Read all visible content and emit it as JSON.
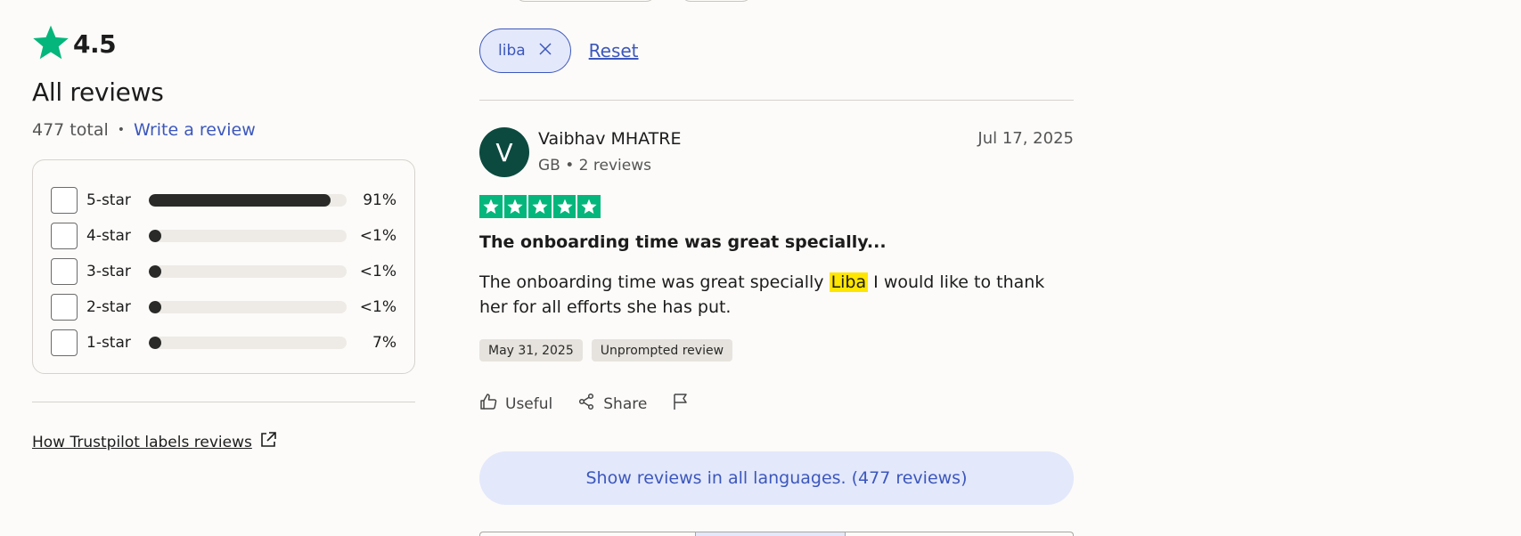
{
  "summary": {
    "rating": "4.5",
    "heading": "All reviews",
    "total": "477 total",
    "separator": "•",
    "write_review": "Write a review"
  },
  "distribution": [
    {
      "label": "5-star",
      "percent": "91%",
      "fill_fraction": 0.91
    },
    {
      "label": "4-star",
      "percent": "<1%",
      "fill_fraction": 0.0
    },
    {
      "label": "3-star",
      "percent": "<1%",
      "fill_fraction": 0.0
    },
    {
      "label": "2-star",
      "percent": "<1%",
      "fill_fraction": 0.0
    },
    {
      "label": "1-star",
      "percent": "7%",
      "fill_fraction": 0.0
    }
  ],
  "how_link": "How Trustpilot labels reviews",
  "filters": {
    "active_chip": "liba",
    "reset": "Reset"
  },
  "review": {
    "avatar_letter": "V",
    "author": "Vaibhav MHATRE",
    "meta": "GB • 2 reviews",
    "date": "Jul 17, 2025",
    "stars": 5,
    "title": "The onboarding time was great specially...",
    "body_before": "The onboarding time was great specially ",
    "body_highlight": "Liba",
    "body_after": " I would like to thank her for all efforts she has put.",
    "experience_date": "May 31, 2025",
    "source_tag": "Unprompted review",
    "useful": "Useful",
    "share": "Share"
  },
  "show_all_languages": "Show reviews in all languages. (477 reviews)",
  "colors": {
    "brand_green": "#04b67b",
    "link_blue": "#3c57bc",
    "highlight": "#ffe600"
  },
  "icons": [
    "star-icon",
    "close-icon",
    "external-link-icon",
    "thumbs-up-icon",
    "share-icon",
    "flag-icon"
  ]
}
